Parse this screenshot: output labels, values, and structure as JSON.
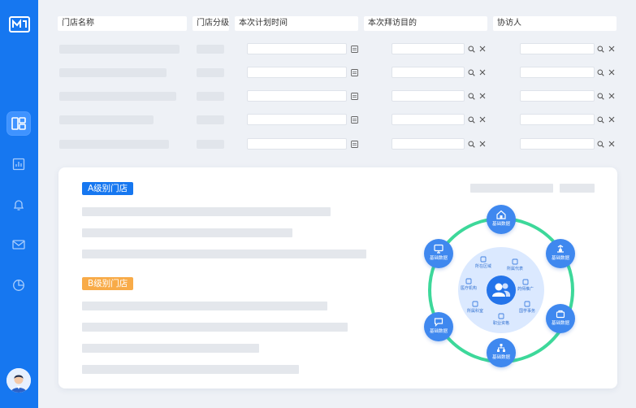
{
  "colors": {
    "sidebar": "#1677f0",
    "accent": "#1677f0",
    "tag_b": "#f8ab48",
    "ring": "#3dd89a",
    "node": "#3f88ef"
  },
  "sidebar": {
    "icons": [
      "logo-icon",
      "dashboard-icon",
      "chart-icon",
      "bell-icon",
      "mail-icon",
      "pie-chart-icon"
    ]
  },
  "table": {
    "headers": [
      "门店名称",
      "门店分级",
      "本次计划时间",
      "本次拜访目的",
      "协访人"
    ]
  },
  "card": {
    "tag_a": "A级别门店",
    "tag_b": "B级别门店"
  },
  "diagram": {
    "outer_nodes": [
      "基础数据",
      "基础数据",
      "基础数据",
      "基础数据",
      "基础数据",
      "基础数据"
    ],
    "inner_items": [
      "所在区域",
      "所属代表",
      "医疗机构",
      "药师推广",
      "所属科室",
      "国学事务",
      "职业资格"
    ]
  }
}
